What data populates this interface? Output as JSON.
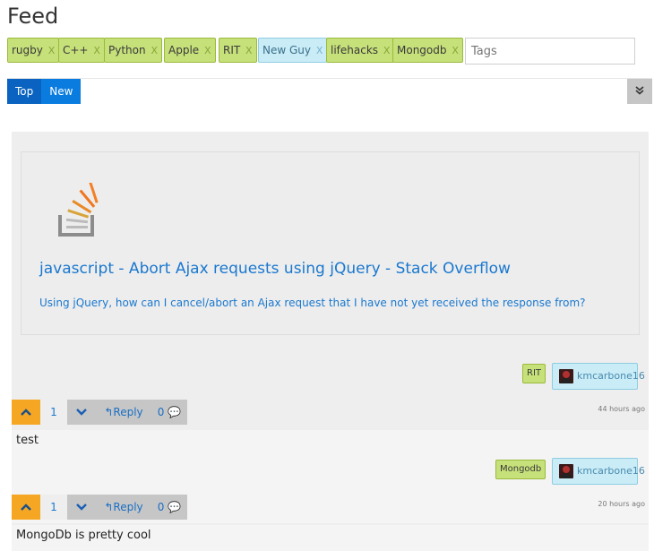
{
  "page": {
    "title": "Feed"
  },
  "tags": [
    {
      "label": "rugby",
      "remove": "X",
      "style": "green"
    },
    {
      "label": "C++",
      "remove": "X",
      "style": "green"
    },
    {
      "label": "Python",
      "remove": "X",
      "style": "green"
    },
    {
      "label": "Apple",
      "remove": "X",
      "style": "green"
    },
    {
      "label": "RIT",
      "remove": "X",
      "style": "green"
    },
    {
      "label": "New Guy",
      "remove": "X",
      "style": "blue"
    },
    {
      "label": "lifehacks",
      "remove": "X",
      "style": "green"
    },
    {
      "label": "Mongodb",
      "remove": "X",
      "style": "green"
    }
  ],
  "tags_input": {
    "placeholder": "Tags",
    "value": ""
  },
  "sort": {
    "top_label": "Top",
    "new_label": "New",
    "active": "New"
  },
  "collapse": {
    "icon": "double-chevron-down-icon"
  },
  "post": {
    "link": {
      "icon": "stackoverflow-logo",
      "title": "javascript - Abort Ajax requests using jQuery - Stack Overflow",
      "description": "Using jQuery, how can I cancel/abort an Ajax request that I have not yet received the response from?"
    },
    "tag": "RIT",
    "user": "kmcarbone16",
    "votes": "1",
    "reply_label": "Reply",
    "comment_count": "0",
    "timestamp": "44 hours ago"
  },
  "comments": [
    {
      "text": "test",
      "tag": "Mongodb",
      "user": "kmcarbone16",
      "votes": "1",
      "reply_label": "Reply",
      "comment_count": "0",
      "timestamp": "20 hours ago"
    },
    {
      "text": "MongoDb is pretty cool"
    }
  ],
  "colors": {
    "tag_green": "#c6e07a",
    "tag_blue": "#c9ecf6",
    "accent_blue": "#0a7ce0",
    "upvote_orange": "#f5a623",
    "link_blue": "#1a78cf"
  }
}
